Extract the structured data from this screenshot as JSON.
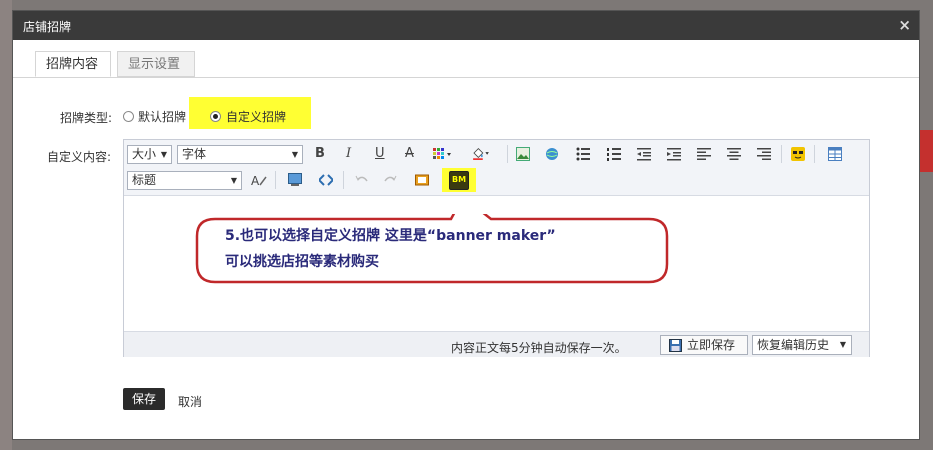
{
  "dialog": {
    "title": "店铺招牌",
    "close": "×"
  },
  "tabs": [
    {
      "label": "招牌内容"
    },
    {
      "label": "显示设置"
    }
  ],
  "form": {
    "type_label": "招牌类型:",
    "option_default": "默认招牌",
    "option_custom": "自定义招牌",
    "selected": "自定义招牌",
    "content_label": "自定义内容:"
  },
  "toolbar": {
    "size_select": "大小",
    "font_select": "字体",
    "heading_select": "标题",
    "bold": "B",
    "italic": "I",
    "underline": "U",
    "strike": "A",
    "bm": "BM"
  },
  "footer": {
    "autosave": "内容正文每5分钟自动保存一次。",
    "save_now": "立即保存",
    "restore": "恢复编辑历史"
  },
  "annotation": {
    "line1": "5.也可以选择自定义招牌  这里是“banner maker”",
    "line2": "可以挑选店招等素材购买"
  },
  "actions": {
    "save": "保存",
    "cancel": "取消"
  },
  "colors": {
    "highlight": "#ffff33",
    "titlebar": "#3a3a3a",
    "callout_border": "#c0282a",
    "callout_text": "#2a2a7a"
  }
}
